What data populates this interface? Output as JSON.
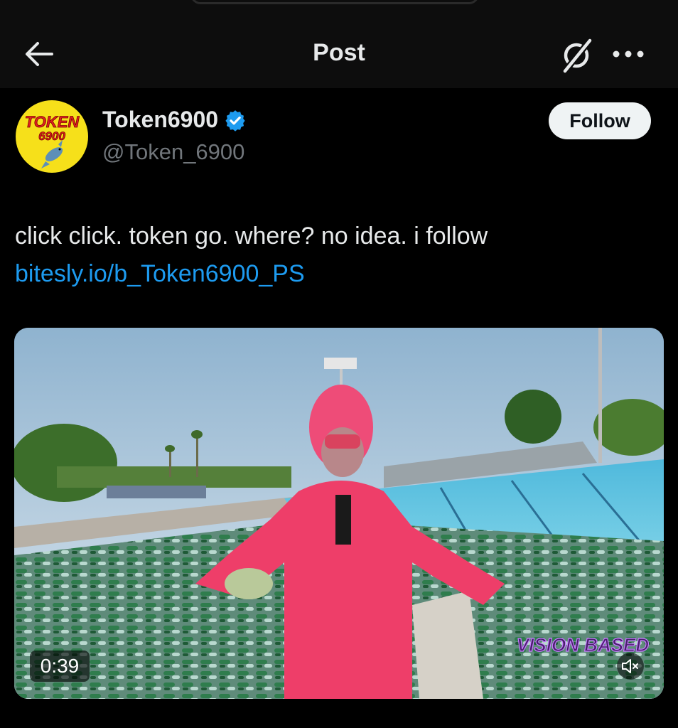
{
  "header": {
    "title": "Post",
    "back_icon": "arrow-left-icon",
    "grok_icon": "grok-icon",
    "more_icon": "more-horizontal-icon"
  },
  "author": {
    "display_name": "Token6900",
    "handle": "@Token_6900",
    "verified": true,
    "avatar_text": "TOKEN 6900",
    "follow_label": "Follow"
  },
  "post": {
    "text": "click click. token go. where? no idea. i follow",
    "link": "bitesly.io/b_Token6900_PS"
  },
  "video": {
    "duration": "0:39",
    "watermark": "VISION BASED",
    "muted": true,
    "mute_icon": "volume-muted-icon"
  },
  "colors": {
    "background": "#000000",
    "link": "#1d9bf0",
    "verified": "#1d9bf0",
    "handle": "#71767b",
    "follow_button": "#eff3f4"
  }
}
